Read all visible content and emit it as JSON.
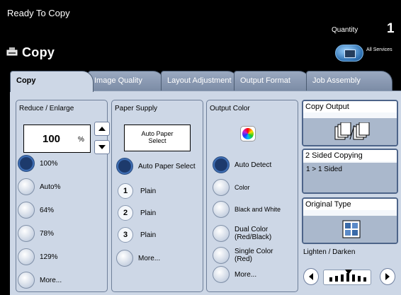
{
  "header": {
    "status": "Ready To Copy",
    "quantity_label": "Quantity",
    "quantity_value": "1"
  },
  "titlebar": {
    "title": "Copy",
    "all_services": "All Services"
  },
  "tabs": [
    {
      "label": "Copy",
      "active": true
    },
    {
      "label": "Image Quality",
      "active": false
    },
    {
      "label": "Layout Adjustment",
      "active": false
    },
    {
      "label": "Output Format",
      "active": false
    },
    {
      "label": "Job Assembly",
      "active": false
    }
  ],
  "reduce_enlarge": {
    "title": "Reduce / Enlarge",
    "value": "100",
    "unit": "%",
    "options": [
      {
        "label": "100%",
        "selected": true
      },
      {
        "label": "Auto%",
        "selected": false
      },
      {
        "label": "64%",
        "selected": false
      },
      {
        "label": "78%",
        "selected": false
      },
      {
        "label": "129%",
        "selected": false
      },
      {
        "label": "More...",
        "selected": false
      }
    ]
  },
  "paper_supply": {
    "title": "Paper Supply",
    "box_line1": "Auto Paper",
    "box_line2": "Select",
    "options": [
      {
        "num": "",
        "label": "Auto Paper Select",
        "selected": true
      },
      {
        "num": "1",
        "label": "Plain"
      },
      {
        "num": "2",
        "label": "Plain"
      },
      {
        "num": "3",
        "label": "Plain"
      },
      {
        "num": "",
        "label": "More..."
      }
    ]
  },
  "output_color": {
    "title": "Output Color",
    "options": [
      {
        "label": "Auto Detect",
        "selected": true
      },
      {
        "label": "Color",
        "selected": false
      },
      {
        "label": "Black and White",
        "selected": false
      },
      {
        "label_line1": "Dual Color",
        "label_line2": "(Red/Black)",
        "selected": false
      },
      {
        "label_line1": "Single Color",
        "label_line2": "(Red)",
        "selected": false
      },
      {
        "label": "More...",
        "selected": false
      }
    ]
  },
  "side": {
    "copy_output": {
      "title": "Copy Output",
      "icon": "collated-copies-icon"
    },
    "two_sided": {
      "title": "2 Sided Copying",
      "value": "1 > 1 Sided"
    },
    "original_type": {
      "title": "Original Type",
      "icon": "photo-text-icon"
    },
    "lighten_darken": {
      "label": "Lighten / Darken",
      "level": 0.5
    }
  },
  "colors": {
    "accent": "#1d3a6c",
    "panel": "#cdd7e6",
    "tab_inactive": "#8a9ab4"
  }
}
